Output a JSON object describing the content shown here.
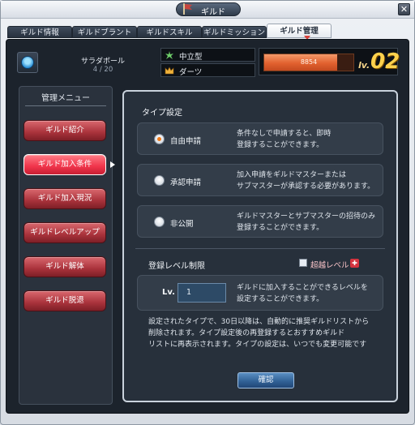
{
  "window": {
    "title": "ギルド",
    "close_label": "✕"
  },
  "tabs": [
    {
      "label": "ギルド情報"
    },
    {
      "label": "ギルドブラント"
    },
    {
      "label": "ギルドスキル"
    },
    {
      "label": "ギルドミッション"
    },
    {
      "label": "ギルド管理",
      "active": true
    }
  ],
  "guild": {
    "name": "サラダボール",
    "members": "4 / 20",
    "alignment": "中立型",
    "master": "ダーツ",
    "exp_text": "8854",
    "exp_fraction": 0.82,
    "level_prefix": "lv.",
    "level": "02"
  },
  "sidebar": {
    "title": "管理メニュー",
    "items": [
      {
        "label": "ギルド紹介"
      },
      {
        "label": "ギルド加入条件",
        "active": true
      },
      {
        "label": "ギルド加入現況"
      },
      {
        "label": "ギルドレベルアップ"
      },
      {
        "label": "ギルド解体"
      },
      {
        "label": "ギルド脱退"
      }
    ]
  },
  "type_settings": {
    "title": "タイプ設定",
    "options": [
      {
        "label": "自由申請",
        "checked": true,
        "desc_1": "条件なしで申請すると、即時",
        "desc_2": "登録することができます。"
      },
      {
        "label": "承認申請",
        "checked": false,
        "desc_1": "加入申請をギルドマスターまたは",
        "desc_2": "サブマスターが承認する必要があります。"
      },
      {
        "label": "非公開",
        "checked": false,
        "desc_1": "ギルドマスターとサブマスターの招待のみ",
        "desc_2": "登録することができます。"
      }
    ]
  },
  "level_limit": {
    "title": "登録レベル制限",
    "overlevel_label": "超越レベル",
    "lv_label": "Lv.",
    "lv_value": "1",
    "desc_1": "ギルドに加入することができるレベルを",
    "desc_2": "設定することができます。"
  },
  "notice": {
    "line_1": "設定されたタイプで、30日以降は、自動的に推奨ギルドリストから",
    "line_2": "削除されます。タイプ設定後の再登録するとおすすめギルド",
    "line_3": "リストに再表示されます。タイプの設定は、いつでも変更可能です"
  },
  "confirm_label": "確認",
  "colors": {
    "accent_red": "#f0344a",
    "exp_orange": "#e2612f",
    "level_gold": "#ffd24d",
    "confirm_blue": "#2f5f93"
  }
}
